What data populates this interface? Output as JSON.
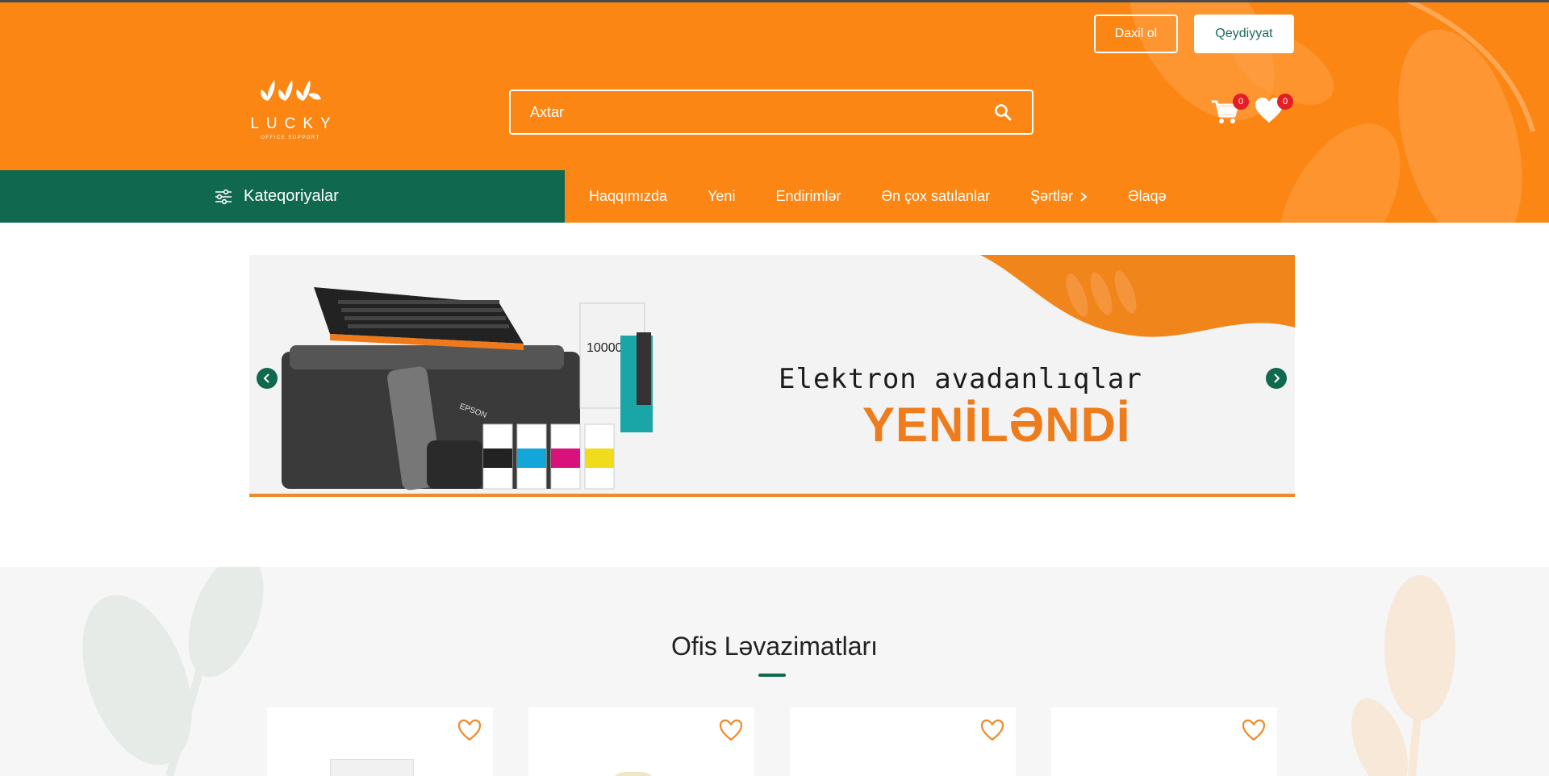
{
  "auth": {
    "login_label": "Daxil ol",
    "register_label": "Qeydiyyat"
  },
  "logo": {
    "word": "LUCKY",
    "sub": "OFFICE SUPPORT"
  },
  "search": {
    "placeholder": "Axtar",
    "icon": "search-icon"
  },
  "cart": {
    "count": "0",
    "icon": "cart-icon"
  },
  "favorites": {
    "count": "0",
    "icon": "heart-icon"
  },
  "categories": {
    "label": "Kateqoriyalar",
    "icon": "sliders-icon"
  },
  "nav": {
    "items": [
      {
        "label": "Haqqımızda"
      },
      {
        "label": "Yeni"
      },
      {
        "label": "Endirimlər"
      },
      {
        "label": "Ən çox satılanlar"
      },
      {
        "label": "Şərtlər",
        "has_submenu": true
      },
      {
        "label": "Əlaqə"
      }
    ]
  },
  "banner": {
    "line1": "Elektron avadanlıqlar",
    "line2": "YENİLƏNDİ",
    "brand_on_device": "EPSON",
    "powerbank_label": "10000"
  },
  "section": {
    "title": "Ofis Ləvazimatları"
  },
  "colors": {
    "brand_orange": "#fb8613",
    "brand_green": "#10694f",
    "badge_red": "#e31e24"
  }
}
